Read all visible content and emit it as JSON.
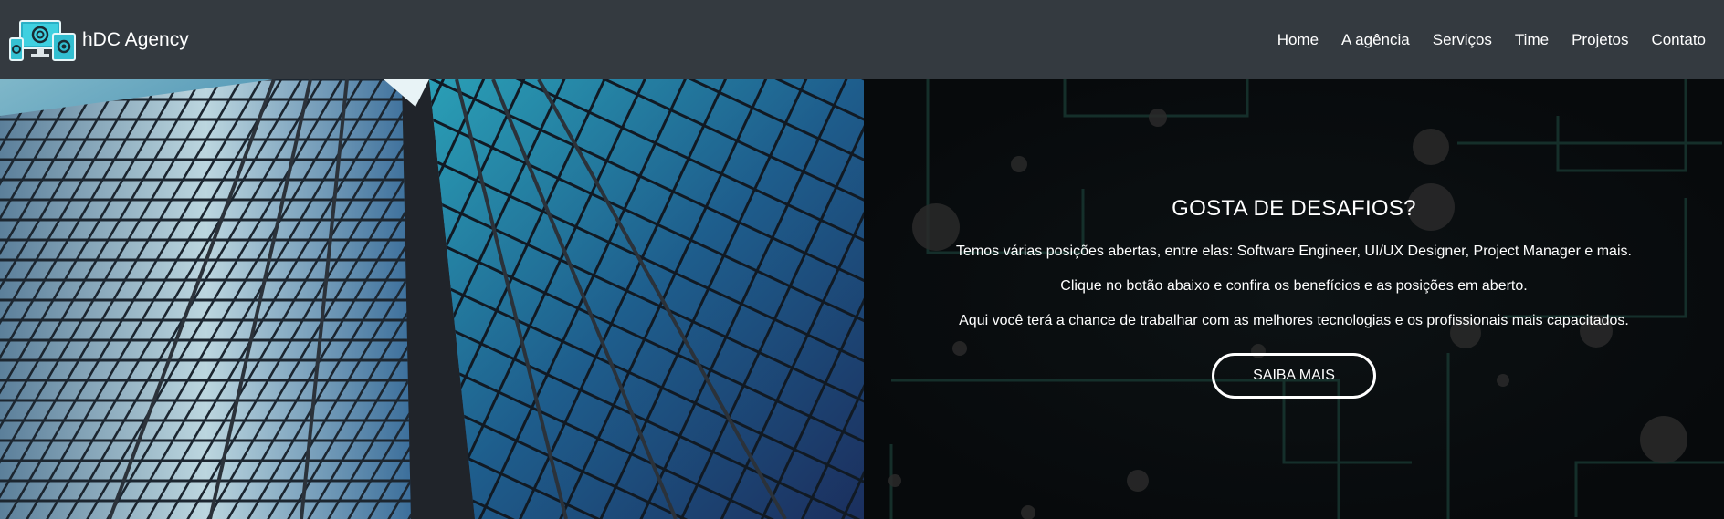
{
  "header": {
    "brand_name": "hDC Agency",
    "logo_icon": "devices-logo-icon",
    "background": "#343a40",
    "nav_items": [
      {
        "label": "Home"
      },
      {
        "label": "A agência"
      },
      {
        "label": "Serviços"
      },
      {
        "label": "Time"
      },
      {
        "label": "Projetos"
      },
      {
        "label": "Contato"
      }
    ]
  },
  "hero": {
    "image_semantic": "glass-skyscraper-photo",
    "heading": "GOSTA DE DESAFIOS?",
    "paragraphs": [
      "Temos várias posições abertas, entre elas: Software Engineer, UI/UX Designer, Project Manager e mais.",
      "Clique no botão abaixo e confira os benefícios e as posições em aberto.",
      "Aqui você terá a chance de trabalhar com as melhores tecnologias e os profissionais mais capacitados."
    ],
    "cta_label": "SAIBA MAIS",
    "background": "#0b0f12",
    "circuit_color": "#1c3b35"
  }
}
